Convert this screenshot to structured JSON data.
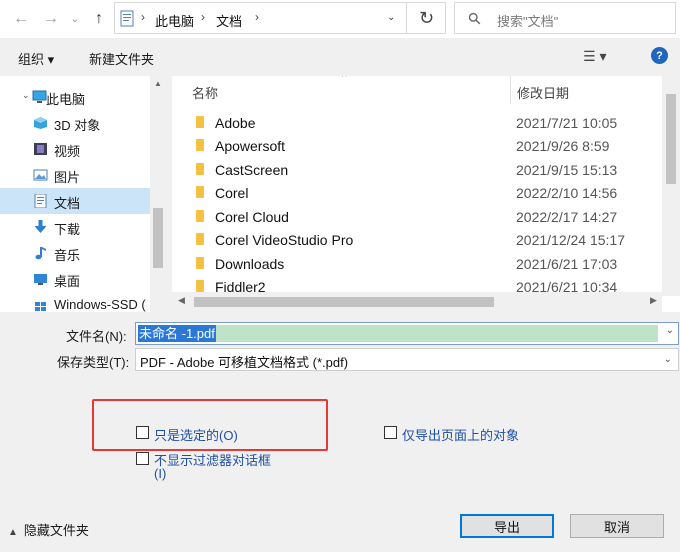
{
  "address": {
    "breadcrumb": [
      "此电脑",
      "文档"
    ],
    "search_placeholder": "搜索\"文档\""
  },
  "toolbar": {
    "organize_label": "组织 ▾",
    "new_folder_label": "新建文件夹",
    "help_label": "?"
  },
  "nav": {
    "items": [
      {
        "label": "此电脑",
        "icon": "computer-icon"
      },
      {
        "label": "3D 对象",
        "icon": "cube-icon"
      },
      {
        "label": "视频",
        "icon": "film-icon"
      },
      {
        "label": "图片",
        "icon": "picture-icon"
      },
      {
        "label": "文档",
        "icon": "document-icon",
        "selected": true
      },
      {
        "label": "下载",
        "icon": "download-arrow-icon"
      },
      {
        "label": "音乐",
        "icon": "music-note-icon"
      },
      {
        "label": "桌面",
        "icon": "desktop-icon"
      },
      {
        "label": "Windows-SSD (",
        "icon": "drive-icon"
      }
    ]
  },
  "file_list": {
    "col_name": "名称",
    "col_modified": "修改日期",
    "rows": [
      {
        "name": "Adobe",
        "modified": "2021/7/21 10:05"
      },
      {
        "name": "Apowersoft",
        "modified": "2021/9/26 8:59"
      },
      {
        "name": "CastScreen",
        "modified": "2021/9/15 15:13"
      },
      {
        "name": "Corel",
        "modified": "2022/2/10 14:56"
      },
      {
        "name": "Corel Cloud",
        "modified": "2022/2/17 14:27"
      },
      {
        "name": "Corel VideoStudio Pro",
        "modified": "2021/12/24 15:17"
      },
      {
        "name": "Downloads",
        "modified": "2021/6/21 17:03"
      },
      {
        "name": "Fiddler2",
        "modified": "2021/6/21 10:34"
      }
    ]
  },
  "save": {
    "filename_label": "文件名(N):",
    "filename_value": "未命名 -1.pdf",
    "filetype_label": "保存类型(T):",
    "filetype_value": "PDF - Adobe 可移植文档格式 (*.pdf)"
  },
  "options": {
    "only_selected": "只是选定的(O)",
    "export_page_objects": "仅导出页面上的对象",
    "no_filter_dialog_line1": "不显示过滤器对话框",
    "no_filter_dialog_line2": "(I)"
  },
  "footer": {
    "hide_folders": "隐藏文件夹",
    "export_button": "导出",
    "cancel_button": "取消"
  },
  "colors": {
    "highlight": "#e53935",
    "selection": "#cce4f7",
    "accent": "#0078d7"
  }
}
